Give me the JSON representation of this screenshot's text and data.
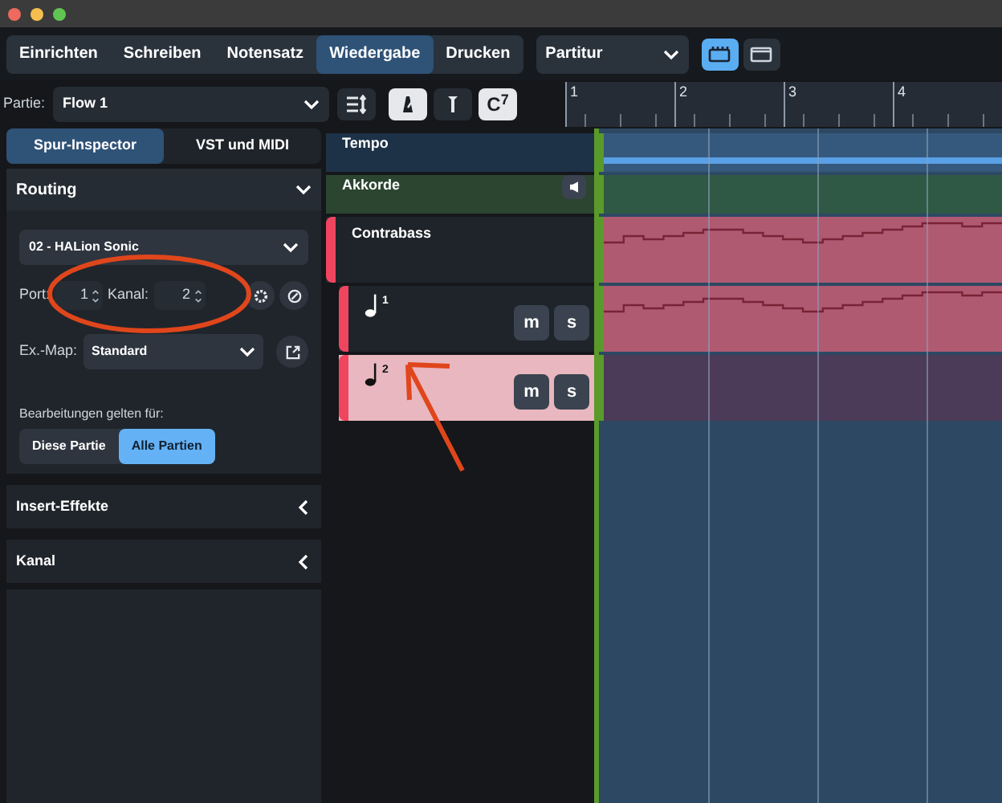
{
  "mode_tabs": [
    {
      "label": "Einrichten",
      "selected": false
    },
    {
      "label": "Schreiben",
      "selected": false
    },
    {
      "label": "Notensatz",
      "selected": false
    },
    {
      "label": "Wiedergabe",
      "selected": true
    },
    {
      "label": "Drucken",
      "selected": false
    }
  ],
  "layout_select": {
    "value": "Partitur"
  },
  "view_buttons": [
    {
      "kind": "galley",
      "selected": true
    },
    {
      "kind": "page",
      "selected": false
    }
  ],
  "part_selector": {
    "label": "Partie:",
    "value": "Flow 1"
  },
  "toolbar_toggles": [
    {
      "kind": "metronome",
      "selected": true
    },
    {
      "kind": "marker",
      "selected": false
    },
    {
      "kind": "chord",
      "label": "C$^{7}$",
      "selected": true
    }
  ],
  "ruler": {
    "bars": [
      "1",
      "2",
      "3",
      "4"
    ]
  },
  "inspector_tabs": [
    {
      "label": "Spur-Inspector",
      "selected": true
    },
    {
      "label": "VST und MIDI",
      "selected": false
    }
  ],
  "routing": {
    "title": "Routing",
    "expanded": true,
    "instrument": "02 - HALion Sonic",
    "port_label": "Port:",
    "port": "1",
    "channel_label": "Kanal:",
    "channel": "2",
    "map_label": "Ex.-Map:",
    "map": "Standard",
    "scope_label": "Bearbeitungen gelten für:",
    "scope": [
      {
        "label": "Diese Partie",
        "selected": false
      },
      {
        "label": "Alle Partien",
        "selected": true
      }
    ]
  },
  "sections": [
    {
      "title": "Insert-Effekte",
      "expanded": false
    },
    {
      "title": "Kanal",
      "expanded": false
    }
  ],
  "tracks": [
    {
      "kind": "tempo",
      "name": "Tempo"
    },
    {
      "kind": "chords",
      "name": "Akkorde"
    },
    {
      "kind": "instrument",
      "name": "Contrabass"
    },
    {
      "kind": "voice",
      "name": "1",
      "selected": false,
      "buttons": [
        "m",
        "s"
      ]
    },
    {
      "kind": "voice",
      "name": "2",
      "selected": true,
      "buttons": [
        "m",
        "s"
      ]
    }
  ]
}
